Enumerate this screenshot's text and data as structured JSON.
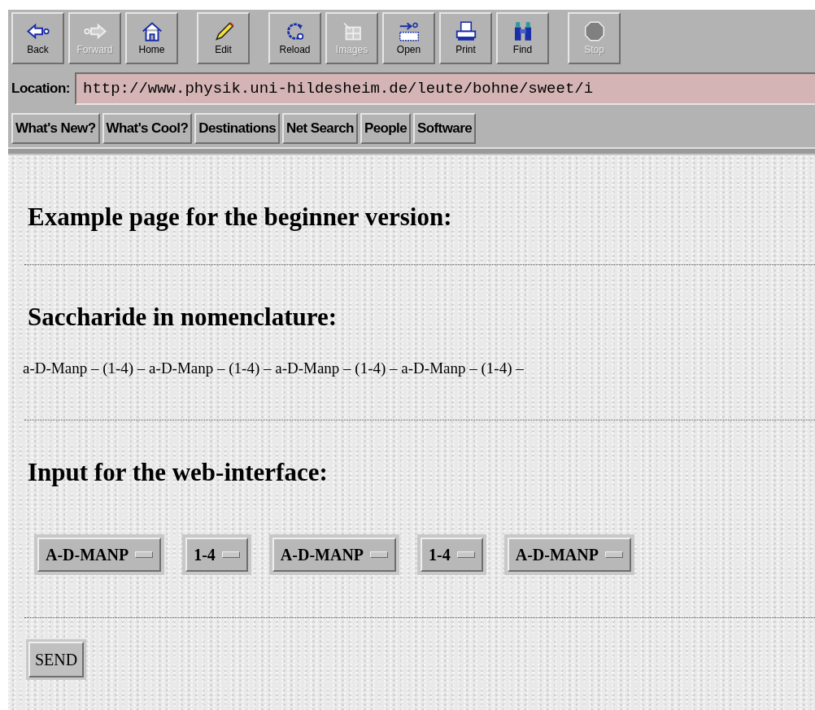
{
  "toolbar_groups": [
    [
      {
        "label": "Back",
        "kind": "back",
        "disabled": false
      },
      {
        "label": "Forward",
        "kind": "forward",
        "disabled": true
      },
      {
        "label": "Home",
        "kind": "home",
        "disabled": false
      }
    ],
    [
      {
        "label": "Edit",
        "kind": "edit",
        "disabled": false
      }
    ],
    [
      {
        "label": "Reload",
        "kind": "reload",
        "disabled": false
      },
      {
        "label": "Images",
        "kind": "images",
        "disabled": true
      },
      {
        "label": "Open",
        "kind": "open",
        "disabled": false
      },
      {
        "label": "Print",
        "kind": "print",
        "disabled": false
      },
      {
        "label": "Find",
        "kind": "find",
        "disabled": false
      }
    ],
    [
      {
        "label": "Stop",
        "kind": "stop",
        "disabled": true
      }
    ]
  ],
  "location": {
    "label": "Location:",
    "value": "http://www.physik.uni-hildesheim.de/leute/bohne/sweet/i"
  },
  "directory_buttons": [
    "What's New?",
    "What's Cool?",
    "Destinations",
    "Net Search",
    "People",
    "Software"
  ],
  "page": {
    "heading": "Example page for the beginner version:",
    "nomenclature_heading": "Saccharide in nomenclature:",
    "nomenclature": "a-D-Manp – (1-4) – a-D-Manp – (1-4) – a-D-Manp – (1-4) – a-D-Manp – (1-4) –",
    "input_heading": "Input for the web-interface:",
    "selects": [
      "A-D-MANP",
      "1-4",
      "A-D-MANP",
      "1-4",
      "A-D-MANP"
    ],
    "send_button": "SEND"
  }
}
